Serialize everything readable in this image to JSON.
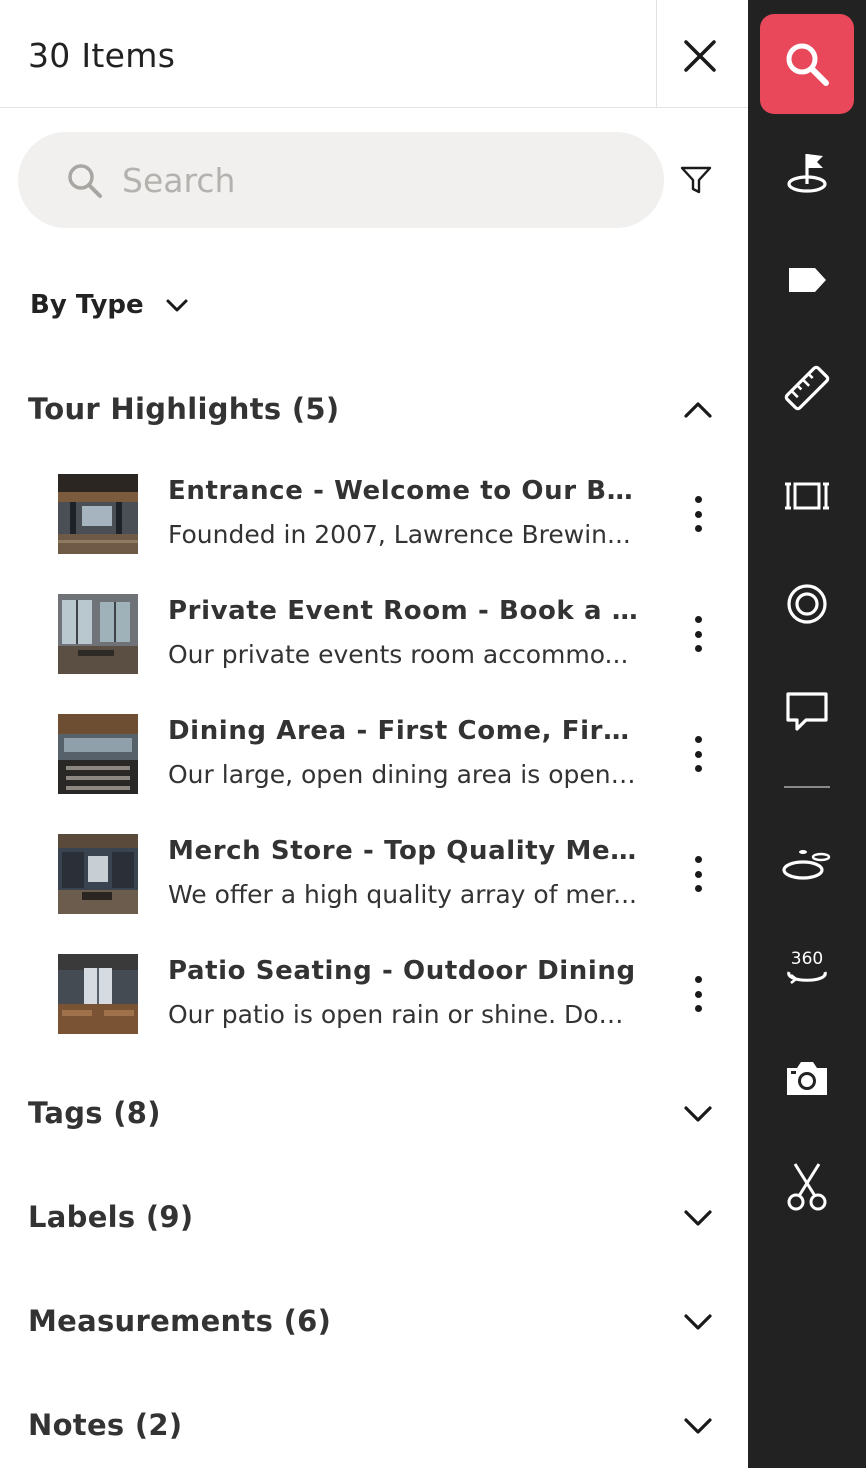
{
  "header": {
    "title": "30 Items"
  },
  "search": {
    "placeholder": "Search",
    "value": ""
  },
  "grouping": {
    "label": "By Type"
  },
  "sections": [
    {
      "title": "Tour Highlights (5)",
      "expanded": true
    },
    {
      "title": "Tags (8)",
      "expanded": false
    },
    {
      "title": "Labels (9)",
      "expanded": false
    },
    {
      "title": "Measurements (6)",
      "expanded": false
    },
    {
      "title": "Notes (2)",
      "expanded": false
    }
  ],
  "highlights": [
    {
      "title": "Entrance - Welcome to Our Bre...",
      "description": "Founded in 2007, Lawrence Brewin..."
    },
    {
      "title": "Private Event Room - Book a Pr...",
      "description": "Our private events room accommo..."
    },
    {
      "title": "Dining Area - First Come, First ...",
      "description": "Our large, open dining area is open ..."
    },
    {
      "title": "Merch Store - Top Quality Merch",
      "description": "We offer a high quality array of mer..."
    },
    {
      "title": "Patio Seating - Outdoor Dining",
      "description": "Our patio is open rain or shine. Dog..."
    }
  ],
  "toolbar": {
    "items": [
      "search-icon",
      "highlight-flag-icon",
      "tag-icon",
      "measure-ruler-icon",
      "floorplan-icon",
      "target-icon",
      "note-icon",
      "floor-view-icon",
      "360-view-icon",
      "camera-icon",
      "scissors-icon"
    ],
    "active": "search-icon",
    "active_color": "#e8485a",
    "background": "#222222"
  }
}
